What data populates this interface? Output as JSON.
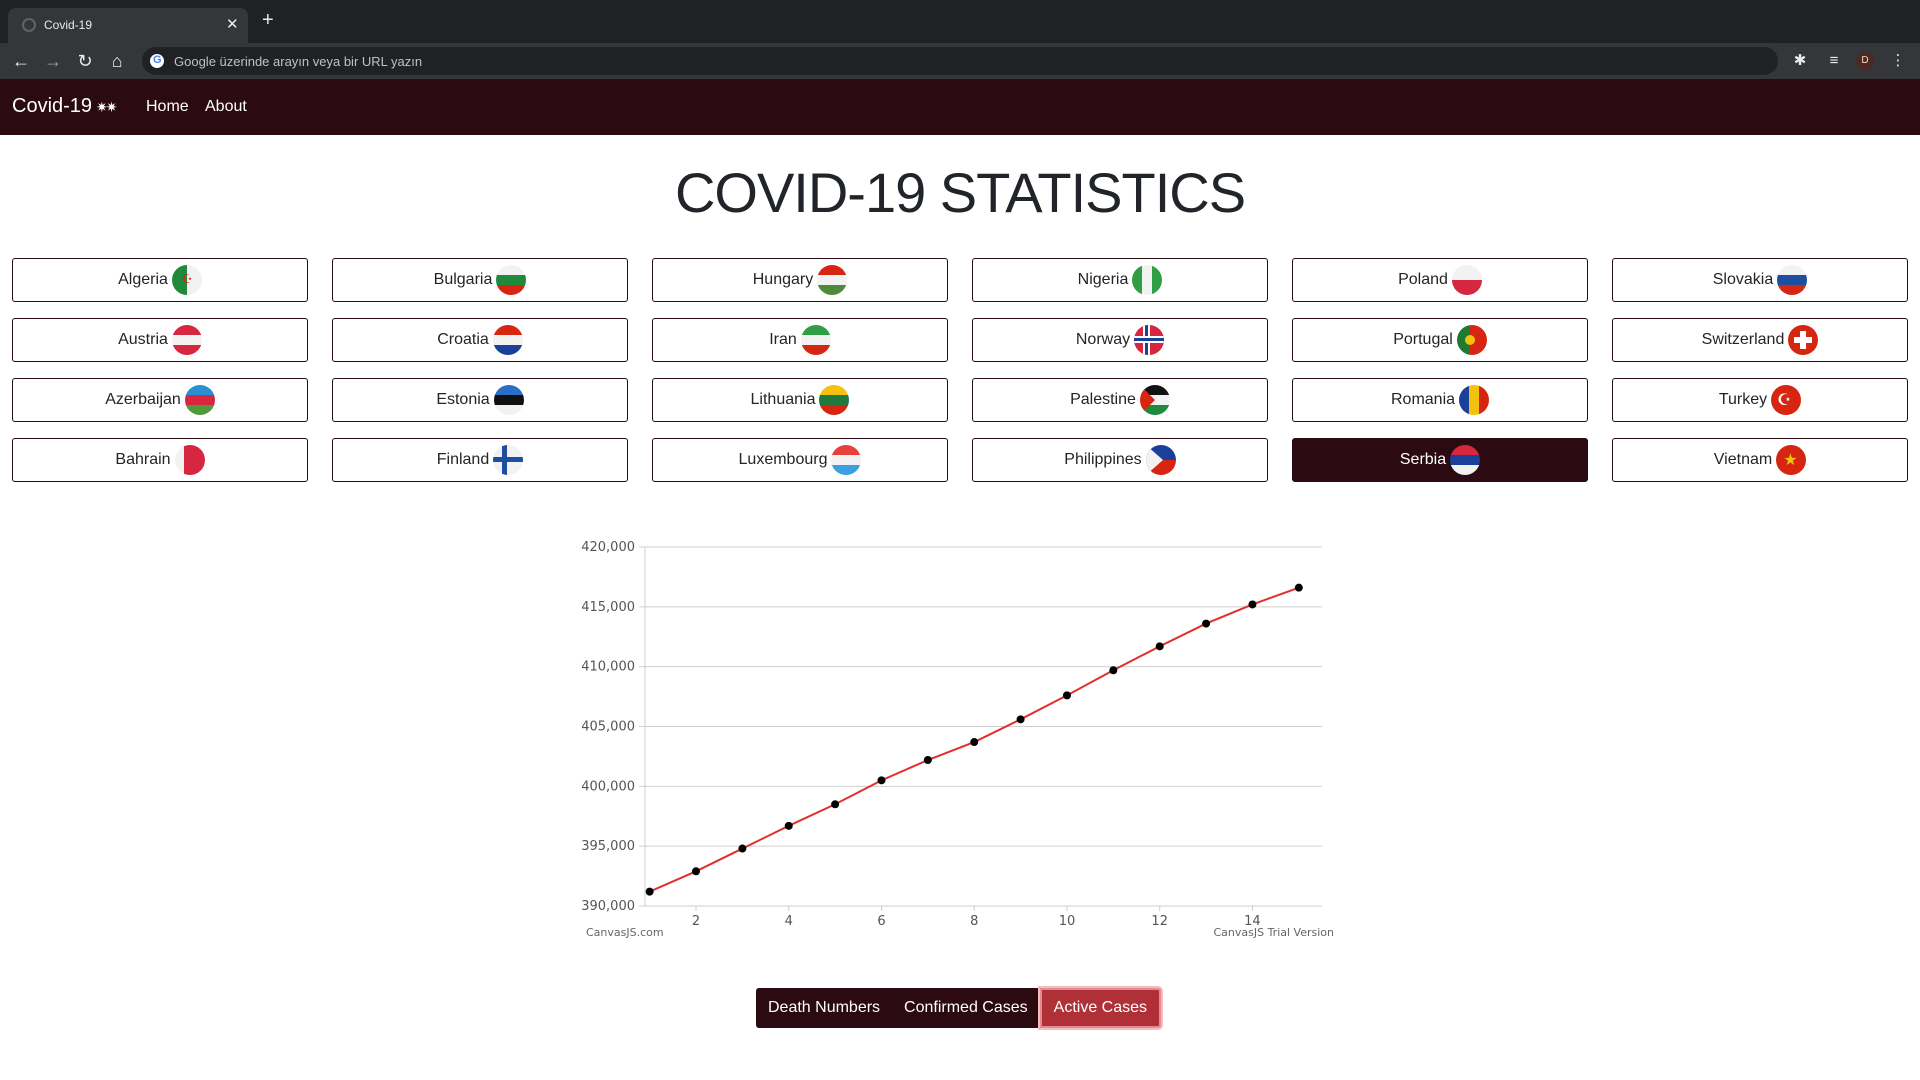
{
  "browser": {
    "tab_title": "Covid-19",
    "omnibox_placeholder": "Google üzerinde arayın veya bir URL yazın",
    "profile_initial": "D",
    "icons": [
      "back-arrow-icon",
      "forward-arrow-icon",
      "reload-icon",
      "home-icon",
      "google-icon",
      "extensions-icon",
      "media-control-icon",
      "menu-icon"
    ]
  },
  "navbar": {
    "brand": "Covid-19",
    "links": [
      "Home",
      "About"
    ]
  },
  "page": {
    "title": "COVID-19 STATISTICS"
  },
  "countries": [
    {
      "name": "Algeria",
      "flag": "algeria"
    },
    {
      "name": "Bulgaria",
      "flag": "bulgaria"
    },
    {
      "name": "Hungary",
      "flag": "hungary"
    },
    {
      "name": "Nigeria",
      "flag": "nigeria"
    },
    {
      "name": "Poland",
      "flag": "poland"
    },
    {
      "name": "Slovakia",
      "flag": "slovakia"
    },
    {
      "name": "Austria",
      "flag": "austria"
    },
    {
      "name": "Croatia",
      "flag": "croatia"
    },
    {
      "name": "Iran",
      "flag": "iran"
    },
    {
      "name": "Norway",
      "flag": "norway"
    },
    {
      "name": "Portugal",
      "flag": "portugal"
    },
    {
      "name": "Switzerland",
      "flag": "switzerland"
    },
    {
      "name": "Azerbaijan",
      "flag": "azerbaijan"
    },
    {
      "name": "Estonia",
      "flag": "estonia"
    },
    {
      "name": "Lithuania",
      "flag": "lithuania"
    },
    {
      "name": "Palestine",
      "flag": "palestine"
    },
    {
      "name": "Romania",
      "flag": "romania"
    },
    {
      "name": "Turkey",
      "flag": "turkey"
    },
    {
      "name": "Bahrain",
      "flag": "bahrain"
    },
    {
      "name": "Finland",
      "flag": "finland"
    },
    {
      "name": "Luxembourg",
      "flag": "luxembourg"
    },
    {
      "name": "Philippines",
      "flag": "philippines"
    },
    {
      "name": "Serbia",
      "flag": "serbia",
      "active": true
    },
    {
      "name": "Vietnam",
      "flag": "vietnam"
    }
  ],
  "chart_data": {
    "type": "line",
    "x": [
      1,
      2,
      3,
      4,
      5,
      6,
      7,
      8,
      9,
      10,
      11,
      12,
      13,
      14,
      15
    ],
    "series": [
      {
        "values": [
          391200,
          392900,
          394800,
          396700,
          398500,
          400500,
          402200,
          403700,
          405600,
          407600,
          409700,
          411700,
          413600,
          415200,
          416600
        ]
      }
    ],
    "ylim": [
      390000,
      420000
    ],
    "yticks": [
      390000,
      395000,
      400000,
      405000,
      410000,
      415000,
      420000
    ],
    "ytick_labels": [
      "390,000",
      "395,000",
      "400,000",
      "405,000",
      "410,000",
      "415,000",
      "420,000"
    ],
    "xlim": [
      0.9,
      15.5
    ],
    "xticks": [
      2,
      4,
      6,
      8,
      10,
      12,
      14
    ],
    "grid": true,
    "line_color": "#e0302c",
    "marker_color": "#000000",
    "credit_left": "CanvasJS.com",
    "credit_right": "CanvasJS Trial Version"
  },
  "toggle": {
    "buttons": [
      "Death Numbers",
      "Confirmed Cases",
      "Active Cases"
    ],
    "active_index": 2
  },
  "colors": {
    "navbar_bg": "#2b0b11",
    "active_toggle": "#b03038"
  }
}
